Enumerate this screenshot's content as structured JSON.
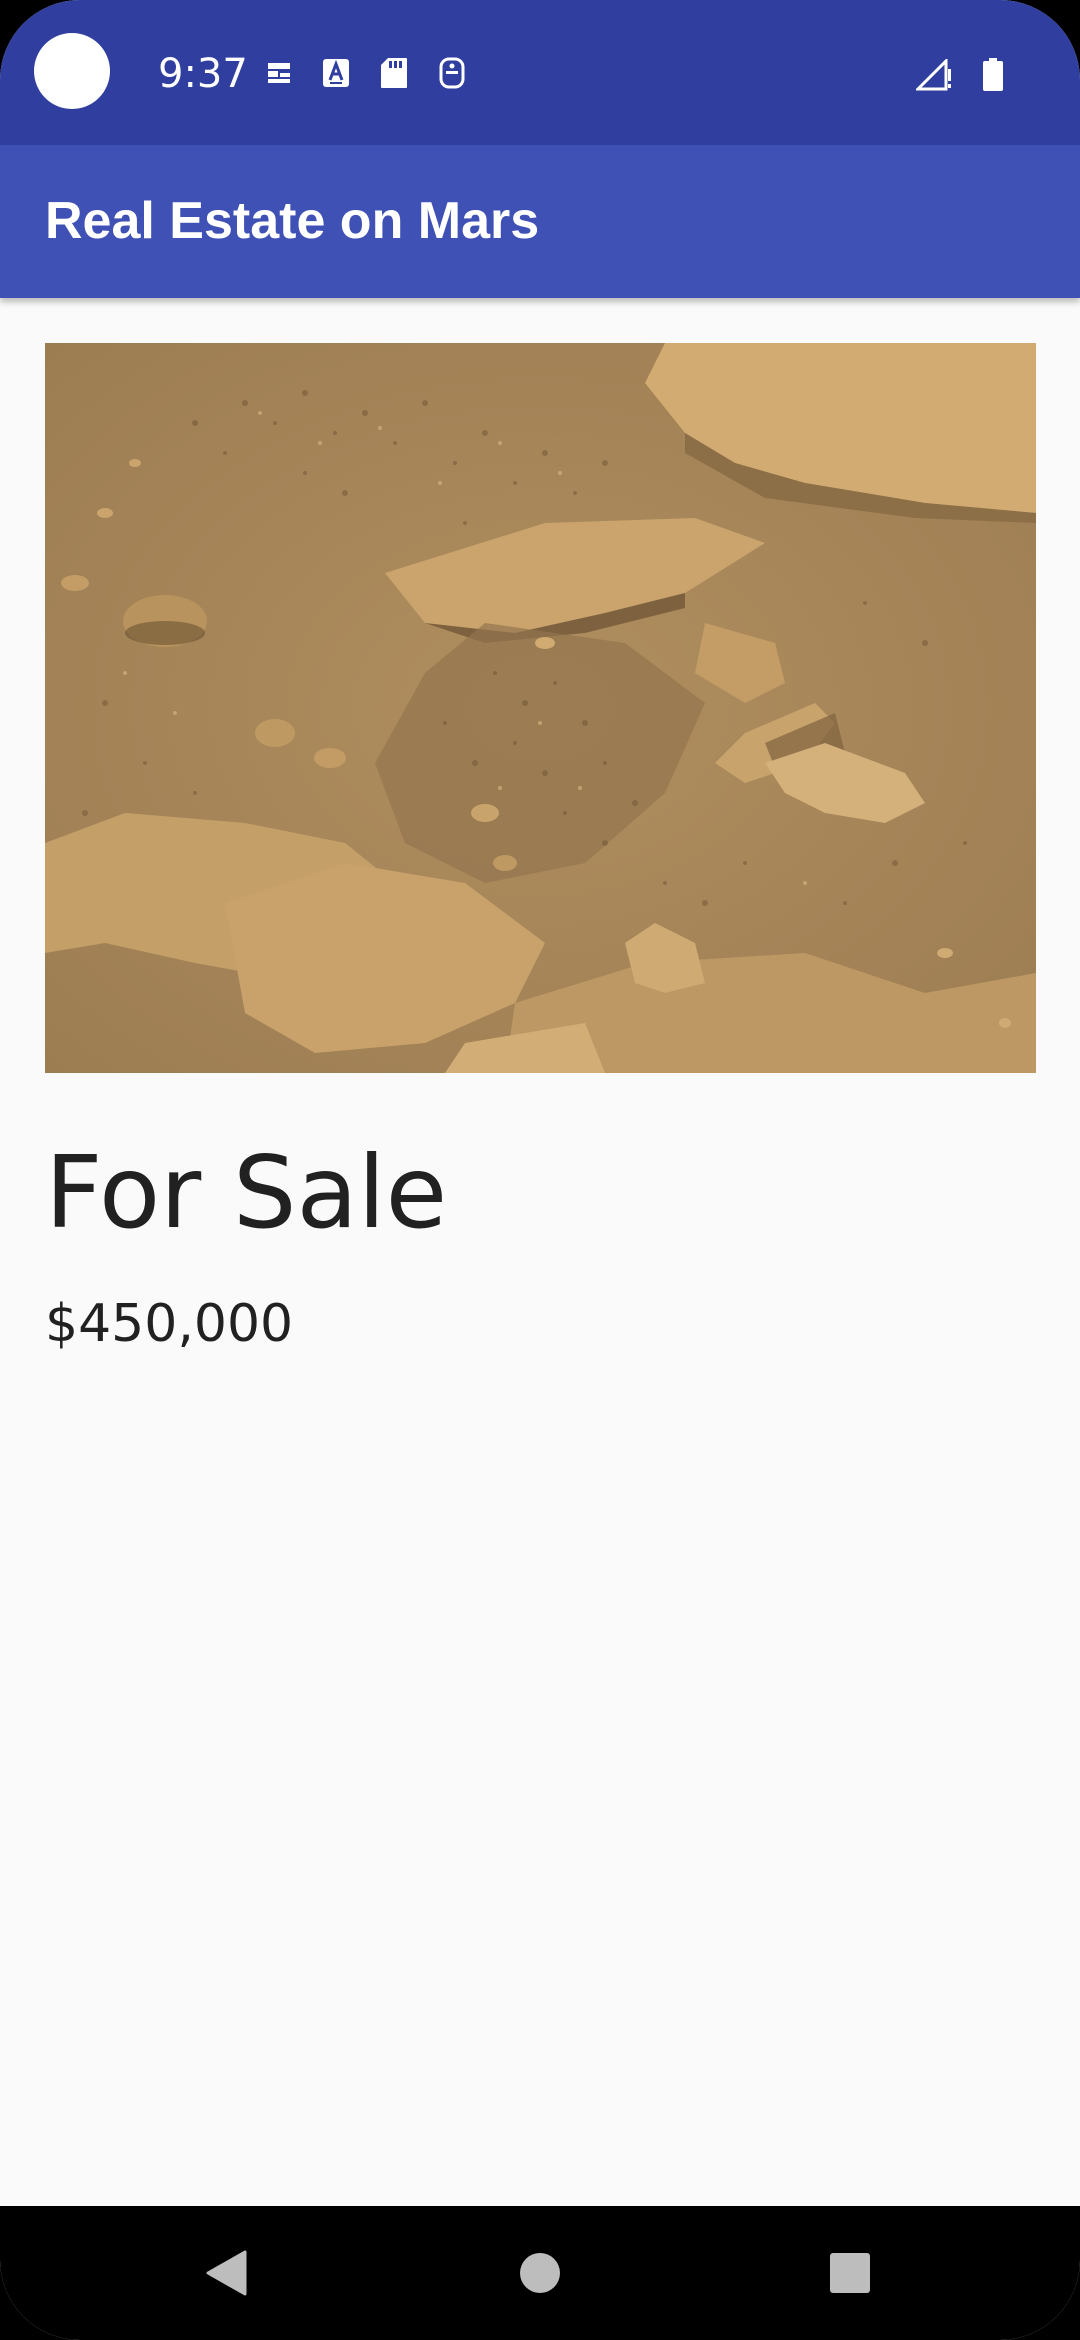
{
  "status_bar": {
    "time": "9:37",
    "background": "#303f9f",
    "left_icons": [
      "notification-icon",
      "font-a-icon",
      "sd-card-icon",
      "accessibility-icon"
    ],
    "right_icons": [
      "signal-icon",
      "battery-icon"
    ]
  },
  "app_bar": {
    "title": "Real Estate on Mars",
    "background": "#3f51b5"
  },
  "listing": {
    "image_alt": "mars-surface-photo",
    "status": "For Sale",
    "price": "$450,000"
  },
  "nav_bar": {
    "buttons": [
      "back-icon",
      "home-icon",
      "recents-icon"
    ]
  }
}
